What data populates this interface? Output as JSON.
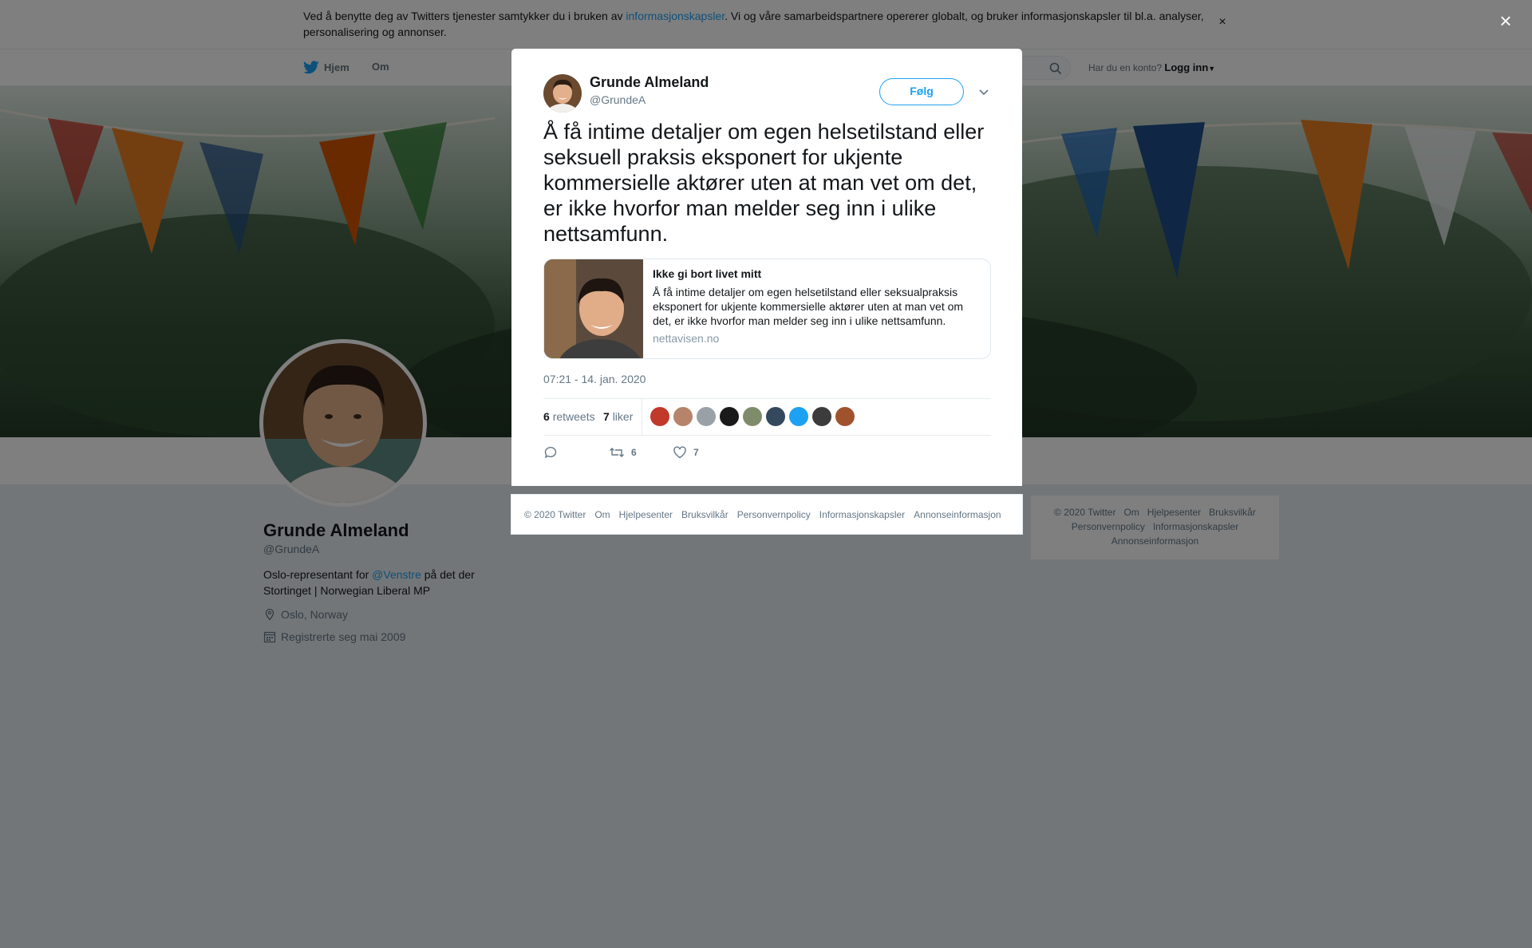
{
  "cookie_banner": {
    "text_before": "Ved å benytte deg av Twitters tjenester samtykker du i bruken av ",
    "link": "informasjonskapsler",
    "text_after": ". Vi og våre samarbeidspartnere opererer globalt, og bruker informasjonskapsler til bl.a. analyser, personalisering og annonser.",
    "close": "×"
  },
  "nav": {
    "home": "Hjem",
    "about": "Om",
    "login_prompt": "Har du en konto?",
    "login": "Logg inn"
  },
  "profile": {
    "name": "Grunde Almeland",
    "handle": "@GrundeA",
    "bio_before": "Oslo-representant for ",
    "bio_mention": "@Venstre",
    "bio_after": " på det der Stortinget | Norwegian Liberal MP",
    "location": "Oslo, Norway",
    "joined": "Registrerte seg mai 2009"
  },
  "right_footer": {
    "items": [
      "© 2020 Twitter",
      "Om",
      "Hjelpesenter",
      "Bruksvilkår",
      "Personvernpolicy",
      "Informasjonskapsler",
      "Annonseinformasjon"
    ]
  },
  "overlay": {
    "close": "×"
  },
  "tweet": {
    "author_name": "Grunde Almeland",
    "author_handle": "@GrundeA",
    "follow": "Følg",
    "text": "Å få intime detaljer om egen helsetilstand eller seksuell praksis eksponert for ukjente kommersielle aktører uten at man vet om det, er ikke hvorfor man melder seg inn i ulike nettsamfunn.",
    "card": {
      "title": "Ikke gi bort livet mitt",
      "description": "Å få intime detaljer om egen helsetilstand eller seksualpraksis eksponert for ukjente kommersielle aktører uten at man vet om det, er ikke hvorfor man melder seg inn i ulike nettsamfunn.",
      "url": "nettavisen.no"
    },
    "timestamp": "07:21 - 14. jan. 2020",
    "retweets_count": "6",
    "retweets_label": "retweets",
    "likes_count": "7",
    "likes_label": "liker",
    "action_retweets": "6",
    "action_likes": "7",
    "liker_avatar_colors": [
      "#c0392b",
      "#b6846a",
      "#9aa1a6",
      "#1a1a1a",
      "#7f8c6b",
      "#34495e",
      "#1da1f2",
      "#3c3c3c",
      "#a0522d"
    ]
  },
  "modal_footer": {
    "items": [
      "© 2020 Twitter",
      "Om",
      "Hjelpesenter",
      "Bruksvilkår",
      "Personvernpolicy",
      "Informasjonskapsler",
      "Annonseinformasjon"
    ]
  },
  "colors": {
    "accent": "#1da1f2",
    "text": "#14171a",
    "muted": "#657786",
    "overlay": "rgba(0,0,0,0.5)"
  }
}
